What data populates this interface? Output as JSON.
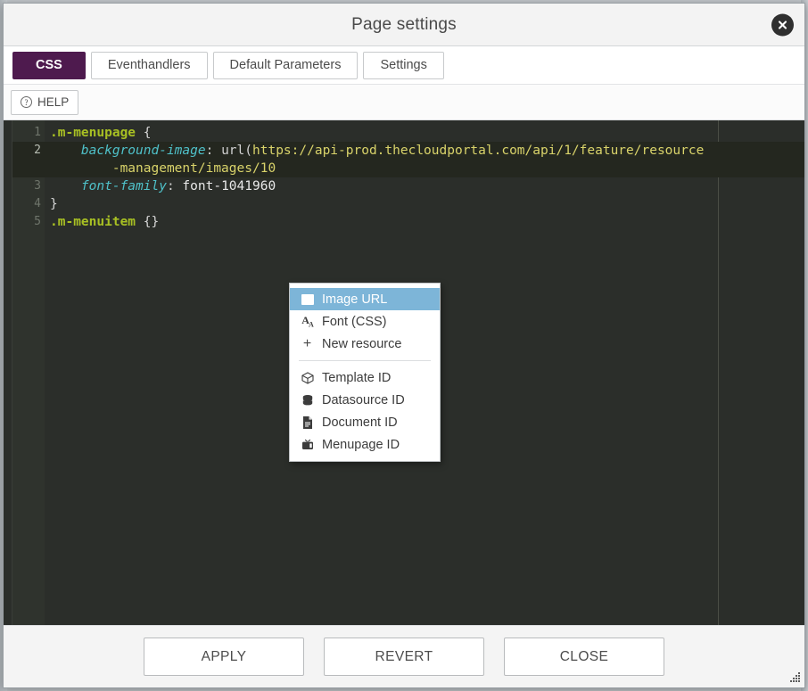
{
  "dialog": {
    "title": "Page settings",
    "close_icon": "close-circle-icon"
  },
  "tabs": [
    {
      "label": "CSS",
      "active": true
    },
    {
      "label": "Eventhandlers",
      "active": false
    },
    {
      "label": "Default Parameters",
      "active": false
    },
    {
      "label": "Settings",
      "active": false
    }
  ],
  "toolbar": {
    "help_label": "HELP",
    "help_icon": "question-circle-icon"
  },
  "editor": {
    "language": "CSS",
    "active_line": 2,
    "gutter_lines": [
      "1",
      "2",
      "",
      "3",
      "4",
      "5"
    ],
    "lines": [
      {
        "number": "1",
        "text": ".m-menupage {",
        "tokens": [
          {
            "t": ".m-menupage",
            "c": "tok-sel"
          },
          {
            "t": " {",
            "c": "tok-punct"
          }
        ]
      },
      {
        "number": "2",
        "text": "    background-image: url(https://api-prod.thecloudportal.com/api/1/feature/resource",
        "tokens": [
          {
            "t": "    ",
            "c": "tok-punct"
          },
          {
            "t": "background-image",
            "c": "tok-prop"
          },
          {
            "t": ": ",
            "c": "tok-colon"
          },
          {
            "t": "url(",
            "c": "tok-fn"
          },
          {
            "t": "https://api-prod.thecloudportal.com/api/1/feature/resource",
            "c": "tok-str"
          }
        ]
      },
      {
        "number": "",
        "text": "        -management/images/10",
        "tokens": [
          {
            "t": "        ",
            "c": "tok-punct"
          },
          {
            "t": "-management/images/10",
            "c": "tok-str"
          }
        ]
      },
      {
        "number": "3",
        "text": "    font-family: font-1041960",
        "tokens": [
          {
            "t": "    ",
            "c": "tok-punct"
          },
          {
            "t": "font-family",
            "c": "tok-prop"
          },
          {
            "t": ": ",
            "c": "tok-colon"
          },
          {
            "t": "font-1041960",
            "c": "tok-val"
          }
        ]
      },
      {
        "number": "4",
        "text": "}",
        "tokens": [
          {
            "t": "}",
            "c": "tok-punct"
          }
        ]
      },
      {
        "number": "5",
        "text": ".m-menuitem {}",
        "tokens": [
          {
            "t": ".m-menuitem",
            "c": "tok-sel"
          },
          {
            "t": " {}",
            "c": "tok-punct"
          }
        ]
      }
    ]
  },
  "context_menu": {
    "groups": [
      [
        {
          "label": "Image URL",
          "icon": "image-icon",
          "selected": true
        },
        {
          "label": "Font (CSS)",
          "icon": "font-icon",
          "selected": false
        },
        {
          "label": "New resource",
          "icon": "plus-icon",
          "selected": false
        }
      ],
      [
        {
          "label": "Template ID",
          "icon": "cube-icon",
          "selected": false
        },
        {
          "label": "Datasource ID",
          "icon": "database-icon",
          "selected": false
        },
        {
          "label": "Document ID",
          "icon": "document-icon",
          "selected": false
        },
        {
          "label": "Menupage ID",
          "icon": "monitor-icon",
          "selected": false
        }
      ]
    ]
  },
  "footer": {
    "buttons": [
      {
        "label": "APPLY"
      },
      {
        "label": "REVERT"
      },
      {
        "label": "CLOSE"
      }
    ]
  },
  "colors": {
    "accent_purple": "#4e1a4e",
    "menu_highlight_blue": "#7db5d8",
    "editor_background": "#2b2e2a",
    "gutter_background": "#2f332d",
    "selector_green": "#a8c023",
    "property_cyan": "#4fc1c9",
    "string_yellow": "#d9d36a"
  }
}
